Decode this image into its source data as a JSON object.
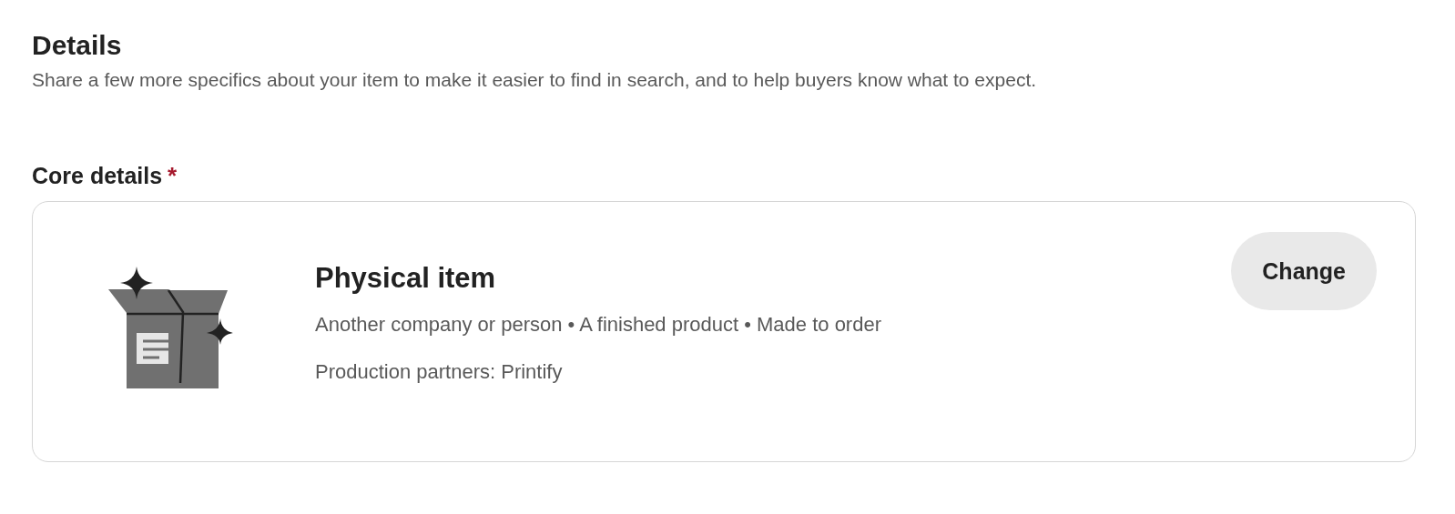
{
  "section": {
    "title": "Details",
    "description": "Share a few more specifics about your item to make it easier to find in search, and to help buyers know what to expect."
  },
  "core_details": {
    "label": "Core details",
    "required": true,
    "required_mark": "*",
    "card": {
      "title": "Physical item",
      "summary": "Another company or person • A finished product • Made to order",
      "partners": "Production partners: Printify",
      "button": "Change"
    }
  }
}
